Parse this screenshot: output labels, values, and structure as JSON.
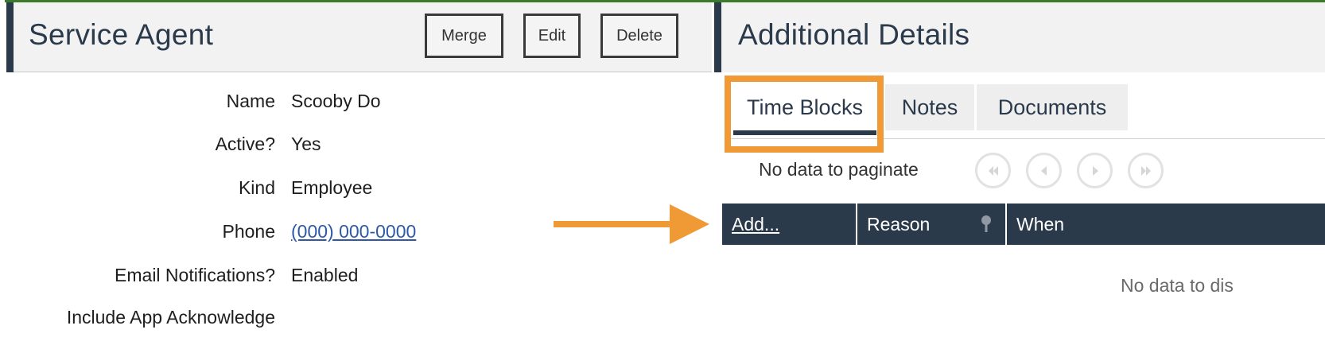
{
  "service_agent": {
    "title": "Service Agent",
    "buttons": {
      "merge": "Merge",
      "edit": "Edit",
      "delete": "Delete"
    },
    "fields": [
      {
        "label": "Name",
        "value": "Scooby Do"
      },
      {
        "label": "Active?",
        "value": "Yes"
      },
      {
        "label": "Kind",
        "value": "Employee"
      },
      {
        "label": "Phone",
        "value": "(000) 000-0000"
      },
      {
        "label": "Email Notifications?",
        "value": "Enabled"
      },
      {
        "label": "Include App Acknowledge",
        "value": ""
      }
    ]
  },
  "additional_details": {
    "title": "Additional Details",
    "tabs": [
      {
        "label": "Time Blocks",
        "active": true
      },
      {
        "label": "Notes",
        "active": false
      },
      {
        "label": "Documents",
        "active": false
      }
    ],
    "pagination": {
      "text": "No data to paginate",
      "icons": [
        "first-page-icon",
        "previous-page-icon",
        "next-page-icon",
        "last-page-icon"
      ]
    },
    "grid": {
      "columns": [
        "Add...",
        "Reason",
        "When"
      ],
      "reason_icon": "filter-icon",
      "empty_text": "No data to dis"
    }
  },
  "annotation": {
    "highlight_color": "#f09a35",
    "arrow_color": "#f09a35",
    "arrow_icon": "right-arrow-icon"
  },
  "colors": {
    "accent": "#2b3a4b",
    "link": "#2d59a8",
    "header_bg": "#f2f2f2"
  }
}
